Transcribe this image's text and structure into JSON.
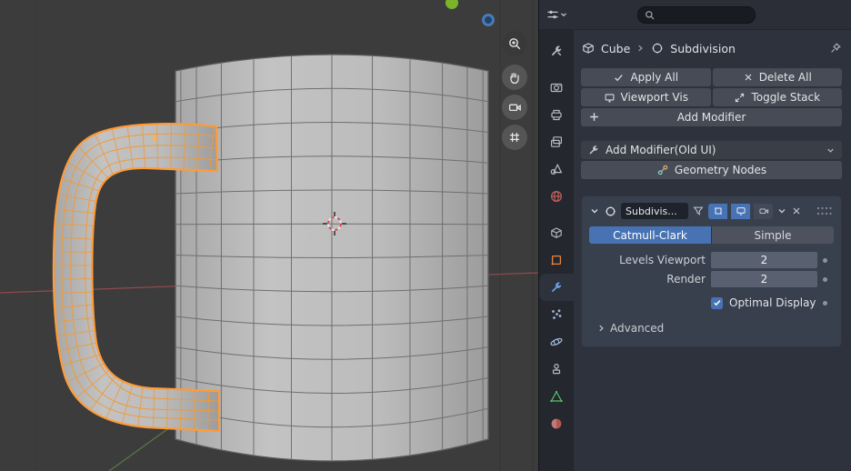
{
  "properties_header": {
    "search_placeholder": ""
  },
  "breadcrumb": {
    "object_label": "Cube",
    "modifier_label": "Subdivision"
  },
  "modifier_actions": {
    "apply_all": "Apply All",
    "delete_all": "Delete All",
    "viewport_vis": "Viewport Vis",
    "toggle_stack": "Toggle Stack",
    "add_modifier": "Add Modifier",
    "add_modifier_old_ui": "Add Modifier(Old UI)",
    "geometry_nodes": "Geometry Nodes"
  },
  "subdivision_panel": {
    "name_value": "Subdivis...",
    "type_tabs": {
      "catmull_clark": "Catmull-Clark",
      "simple": "Simple",
      "active": "Catmull-Clark"
    },
    "levels_viewport": {
      "label": "Levels Viewport",
      "value": "2"
    },
    "render": {
      "label": "Render",
      "value": "2"
    },
    "optimal_display": {
      "label": "Optimal Display",
      "checked": true
    },
    "advanced_label": "Advanced"
  },
  "tab_strip": {
    "active_tab": "modifiers",
    "tabs": [
      "tool",
      "render",
      "output",
      "view-layer",
      "scene",
      "world",
      "collection",
      "object",
      "modifiers",
      "particles",
      "physics",
      "constraints",
      "object-data",
      "material"
    ]
  },
  "viewport": {
    "nav_gizmo_buttons": [
      "zoom",
      "pan",
      "camera-view",
      "grid-ortho"
    ],
    "axis_gizmo_dots": [
      "y-axis-green",
      "z-axis-blue"
    ]
  },
  "colors": {
    "accent_blue": "#4772b3",
    "selection_orange": "#ff9b38"
  }
}
